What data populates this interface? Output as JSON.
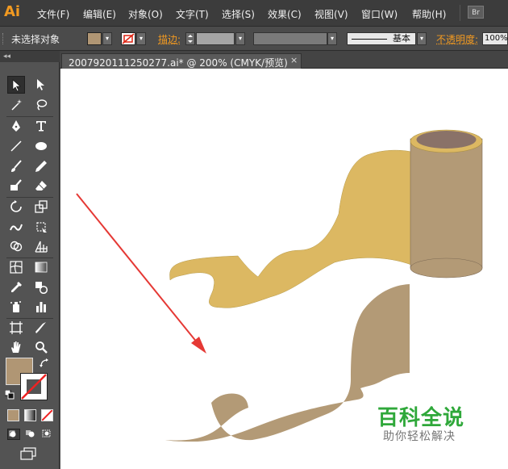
{
  "app": {
    "logo": "Ai",
    "bridge": "Br"
  },
  "menu": [
    "文件(F)",
    "编辑(E)",
    "对象(O)",
    "文字(T)",
    "选择(S)",
    "效果(C)",
    "视图(V)",
    "窗口(W)",
    "帮助(H)"
  ],
  "options_bar": {
    "selection_label": "未选择对象",
    "fill_color": "#b09674",
    "stroke_label": "描边:",
    "brush_label": "基本",
    "opacity_label": "不透明度:",
    "opacity_value": "100%"
  },
  "panel_collapse": "◂◂",
  "document_tab": {
    "label": "2007920111250277.ai* @ 200% (CMYK/预览)",
    "close": "×"
  },
  "tools": [
    "selection-tool",
    "direct-selection-tool",
    "magic-wand-tool",
    "lasso-tool",
    "pen-tool",
    "type-tool",
    "line-tool",
    "ellipse-tool",
    "paintbrush-tool",
    "pencil-tool",
    "blob-brush-tool",
    "eraser-tool",
    "rotate-tool",
    "scale-tool",
    "warp-tool",
    "free-transform-tool",
    "shape-builder-tool",
    "perspective-grid-tool",
    "mesh-tool",
    "gradient-tool",
    "eyedropper-tool",
    "blend-tool",
    "symbol-sprayer-tool",
    "column-graph-tool",
    "artboard-tool",
    "slice-tool",
    "hand-tool",
    "zoom-tool"
  ],
  "colors": {
    "upper_shape_fill": "#dcb862",
    "lower_shape_fill": "#b39a76",
    "cylinder_body": "#b39a76",
    "cylinder_top": "#8a7268",
    "cylinder_rim": "#dcb862",
    "arrow": "#e53935",
    "accent": "#f29a21"
  },
  "watermark": {
    "title": "百科全说",
    "subtitle": "助你轻松解决"
  }
}
